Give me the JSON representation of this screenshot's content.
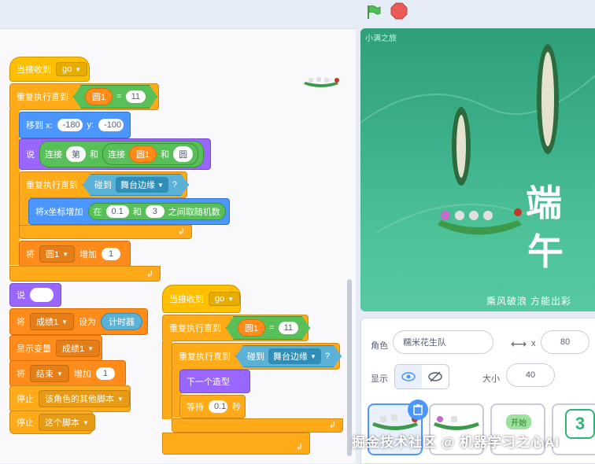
{
  "stage": {
    "title": "小满之旅",
    "slogan": "乘风破浪 方能出彩",
    "chars": [
      "端",
      "午"
    ]
  },
  "script1": {
    "hat": {
      "label": "当接收到",
      "message": "go"
    },
    "repeat_until": {
      "label": "重复执行直到",
      "var": "圆1",
      "op": "=",
      "value": "11"
    },
    "goto": {
      "label": "移到 x:",
      "x": "-180",
      "ylabel": "y:",
      "y": "-100"
    },
    "say": {
      "label": "说",
      "join1": "连接",
      "join1_text": "第",
      "and1": "和",
      "join2": "连接",
      "var": "圆1",
      "and2": "和",
      "join2_text": "圆"
    },
    "inner_repeat": {
      "label": "重复执行直到",
      "touching": "碰到",
      "target": "舞台边缘",
      "q": "?"
    },
    "change_x": {
      "label": "将x坐标增加",
      "in": "在",
      "from": "0.1",
      "and": "和",
      "to": "3",
      "suffix": "之间取随机数"
    },
    "change_var": {
      "label": "将",
      "var": "圆1",
      "by": "增加",
      "value": "1"
    }
  },
  "script1_tail": {
    "say_empty": {
      "label": "说"
    },
    "set_var": {
      "label": "将",
      "var": "成绩1",
      "to": "设为",
      "value": "计时器"
    },
    "show_var": {
      "label": "显示变量",
      "var": "成绩1"
    },
    "change_end": {
      "label": "将",
      "var": "结束",
      "by": "增加",
      "value": "1"
    },
    "stop_other": {
      "label": "停止",
      "option": "该角色的其他脚本"
    },
    "stop_this": {
      "label": "停止",
      "option": "这个脚本"
    }
  },
  "script2": {
    "hat": {
      "label": "当接收到",
      "message": "go"
    },
    "repeat_until": {
      "label": "重复执行直到",
      "var": "圆1",
      "op": "=",
      "value": "11"
    },
    "inner_repeat": {
      "label": "重复执行直到",
      "touching": "碰到",
      "target": "舞台边缘",
      "q": "?"
    },
    "next_costume": {
      "label": "下一个造型"
    },
    "wait": {
      "label": "等待",
      "value": "0.1",
      "unit": "秒"
    }
  },
  "sprite_panel": {
    "sprite_label": "角色",
    "sprite_name": "糯米花生队",
    "x_label": "x",
    "x_value": "80",
    "show_label": "显示",
    "size_label": "大小",
    "size_value": "40",
    "card3_text": "开始"
  },
  "watermark": "掘金技术社区 @ 机器学习之心AI",
  "colors": {
    "events": "#ffbf00",
    "control": "#ffab19",
    "motion": "#4c97ff",
    "looks": "#9966ff",
    "variables": "#ff8c1a",
    "operators": "#59c059",
    "sensing": "#5cb1d6"
  }
}
